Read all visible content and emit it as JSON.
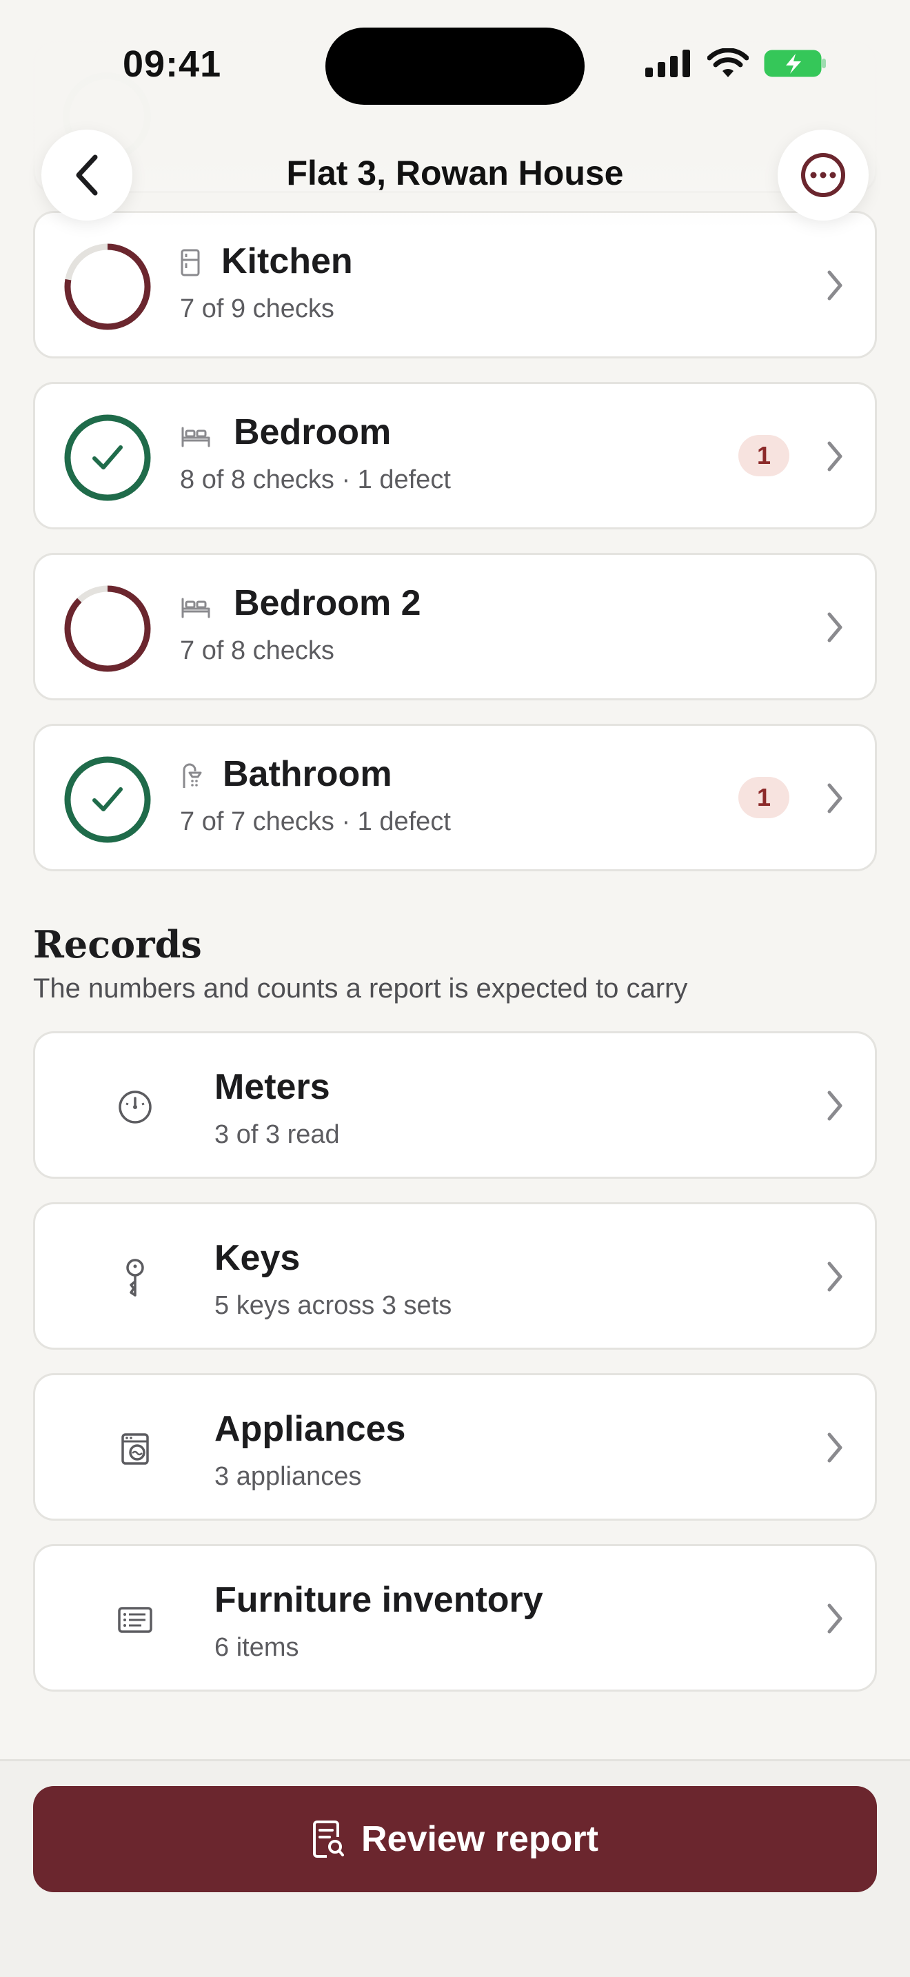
{
  "status_bar": {
    "time": "09:41"
  },
  "nav": {
    "title": "Flat 3, Rowan House",
    "back_icon": "chevron-left-icon",
    "more_icon": "ellipsis-circle-icon"
  },
  "rooms": [
    {
      "name": "Kitchen",
      "subtitle": "7 of 9 checks",
      "icon": "fridge-icon",
      "progress": 0.7778,
      "complete": false,
      "defects": ""
    },
    {
      "name": "Bedroom",
      "subtitle": "8 of 8 checks · 1 defect",
      "icon": "bed-icon",
      "progress": 1.0,
      "complete": true,
      "defects": "1"
    },
    {
      "name": "Bedroom 2",
      "subtitle": "7 of 8 checks",
      "icon": "bed-icon",
      "progress": 0.875,
      "complete": false,
      "defects": ""
    },
    {
      "name": "Bathroom",
      "subtitle": "7 of 7 checks · 1 defect",
      "icon": "shower-icon",
      "progress": 1.0,
      "complete": true,
      "defects": "1"
    }
  ],
  "records": {
    "title": "Records",
    "subtitle": "The numbers and counts a report is expected to carry",
    "items": [
      {
        "name": "Meters",
        "subtitle": "3 of 3 read",
        "icon": "gauge-icon"
      },
      {
        "name": "Keys",
        "subtitle": "5 keys across 3 sets",
        "icon": "key-icon"
      },
      {
        "name": "Appliances",
        "subtitle": "3 appliances",
        "icon": "washing-machine-icon"
      },
      {
        "name": "Furniture inventory",
        "subtitle": "6 items",
        "icon": "list-icon"
      }
    ]
  },
  "footer": {
    "cta_label": "Review report",
    "cta_icon": "document-search-icon"
  },
  "colors": {
    "incomplete_ring": "#6b262e",
    "complete_ring": "#1f6b4a",
    "ring_track": "#e4e2de",
    "badge_bg": "#f7e3df",
    "badge_text": "#8c2a2a",
    "cta_bg": "#6b262e"
  }
}
